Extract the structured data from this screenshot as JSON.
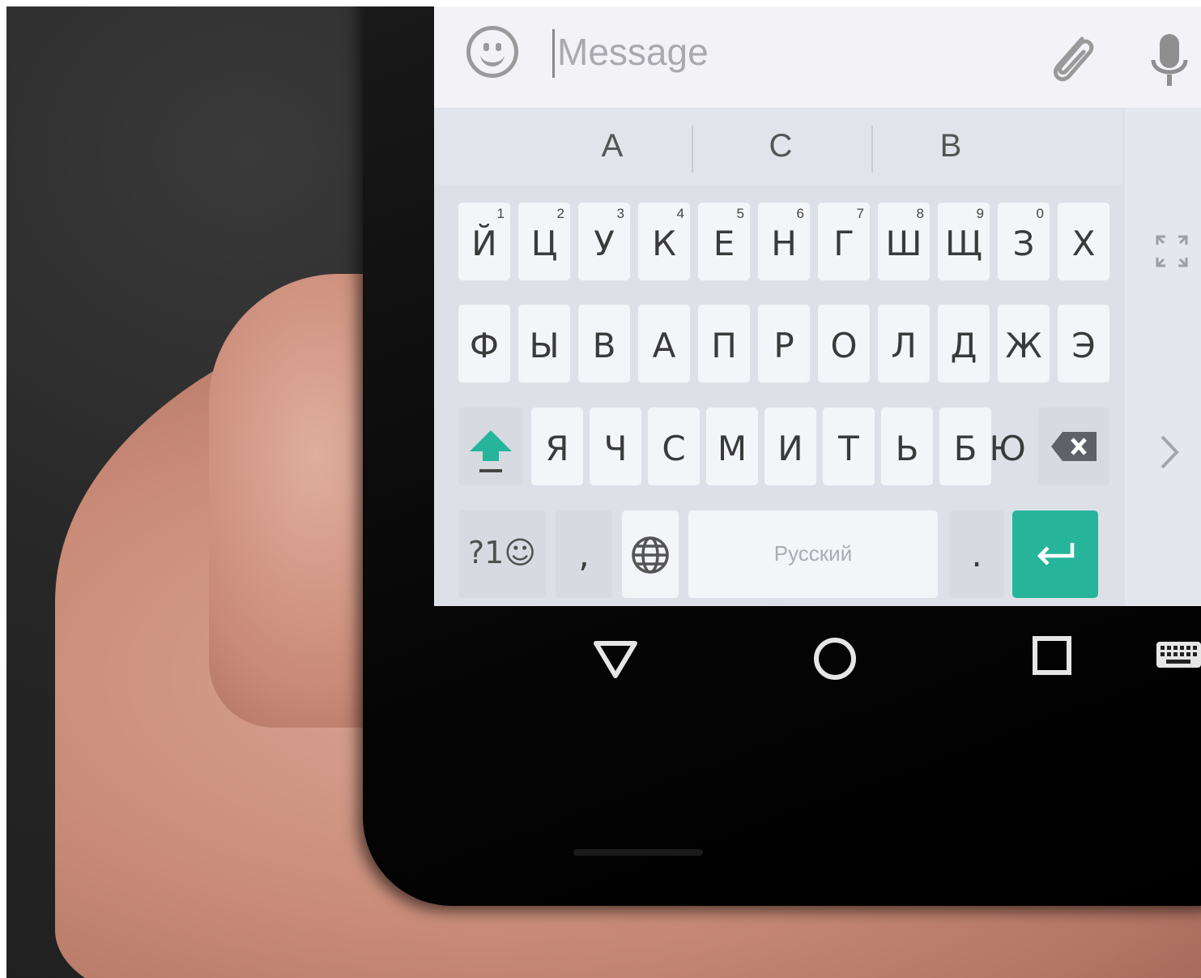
{
  "compose": {
    "placeholder": "Message",
    "emoji_icon": "smiley-icon",
    "attach_icon": "paperclip-icon",
    "mic_icon": "microphone-icon"
  },
  "suggestions": [
    "А",
    "С",
    "В"
  ],
  "keyboard": {
    "row1": [
      {
        "ch": "Й",
        "hint": "1"
      },
      {
        "ch": "Ц",
        "hint": "2"
      },
      {
        "ch": "У",
        "hint": "3"
      },
      {
        "ch": "К",
        "hint": "4"
      },
      {
        "ch": "Е",
        "hint": "5"
      },
      {
        "ch": "Н",
        "hint": "6"
      },
      {
        "ch": "Г",
        "hint": "7"
      },
      {
        "ch": "Ш",
        "hint": "8"
      },
      {
        "ch": "Щ",
        "hint": "9"
      },
      {
        "ch": "З",
        "hint": "0"
      },
      {
        "ch": "Х",
        "hint": ""
      }
    ],
    "row2": [
      "Ф",
      "Ы",
      "В",
      "А",
      "П",
      "Р",
      "О",
      "Л",
      "Д",
      "Ж",
      "Э"
    ],
    "row3": [
      "Я",
      "Ч",
      "С",
      "М",
      "И",
      "Т",
      "Ь",
      "Б",
      "Ю"
    ],
    "symbols_label": "?1☺",
    "comma_label": ",",
    "period_label": ".",
    "space_label": "Русский",
    "shift_icon": "shift-up-arrow-icon",
    "backspace_icon": "backspace-icon",
    "globe_icon": "globe-icon",
    "enter_icon": "enter-return-icon",
    "expand_icon": "expand-arrows-icon",
    "next_icon": "chevron-right-icon",
    "accent_color": "#26b59b"
  },
  "navbar": {
    "back_icon": "back-triangle-icon",
    "home_icon": "home-circle-icon",
    "recents_icon": "recents-square-icon",
    "keyboard_icon": "keyboard-icon"
  }
}
